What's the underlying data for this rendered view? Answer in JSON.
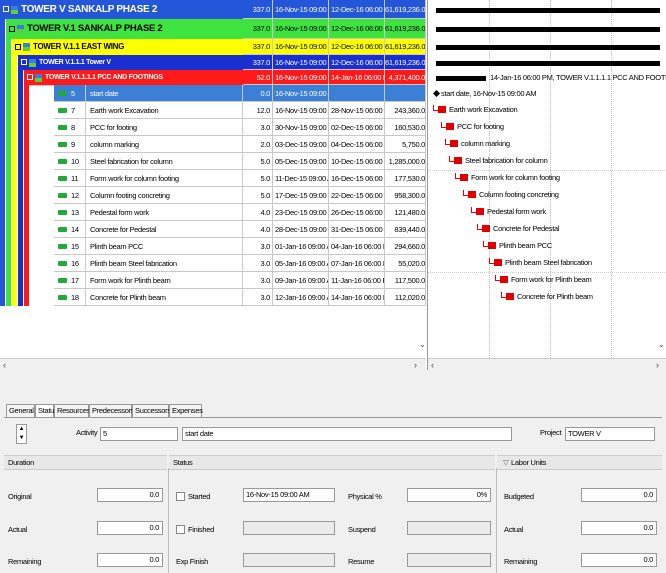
{
  "wbs": [
    {
      "name": "TOWER V  SANKALP PHASE 2",
      "duration": "337.0",
      "start": "16-Nov-15 09:00 AM",
      "finish": "12-Dec-16 06:00 PM",
      "cost": "61,619,236.0",
      "color": "#2456d9",
      "text": "#ffffff",
      "indent": 0,
      "size": "10px"
    },
    {
      "name": "TOWER V.1  SANKALP PHASE 2",
      "duration": "337.0",
      "start": "16-Nov-15 09:00 AM",
      "finish": "12-Dec-16 06:00 PM",
      "cost": "61,619,236.0",
      "color": "#3fe33f",
      "text": "#000000",
      "indent": 1,
      "size": "9.5px"
    },
    {
      "name": "TOWER V.1.1  EAST WING",
      "duration": "337.0",
      "start": "16-Nov-15 09:00 AM",
      "finish": "12-Dec-16 06:00 PM",
      "cost": "61,619,236.0",
      "color": "#ffff00",
      "text": "#000000",
      "indent": 2,
      "size": "8px"
    },
    {
      "name": "TOWER V.1.1.1  Tower V",
      "duration": "337.0",
      "start": "16-Nov-15 09:00 AM",
      "finish": "12-Dec-16 06:00 PM",
      "cost": "61,619,236.0",
      "color": "#1a2fd0",
      "text": "#ffffff",
      "indent": 3,
      "size": "7px"
    },
    {
      "name": "TOWER V.1.1.1.1  PCC AND FOOTINGS",
      "duration": "52.0",
      "start": "16-Nov-15 09:00 AM",
      "finish": "14-Jan-16 06:00 PM",
      "cost": "4,371,400.0",
      "color": "#ff1a1a",
      "text": "#ffffff",
      "indent": 4,
      "size": "7px"
    }
  ],
  "activities": [
    {
      "id": "5",
      "name": "start date",
      "duration": "0.0",
      "start": "16-Nov-15 09:00 AM",
      "finish": "",
      "cost": "",
      "selected": true
    },
    {
      "id": "7",
      "name": "Earth work Excavation",
      "duration": "12.0",
      "start": "16-Nov-15 09:00 AM",
      "finish": "28-Nov-15 06:00 PM",
      "cost": "243,360.0"
    },
    {
      "id": "8",
      "name": "PCC for footing",
      "duration": "3.0",
      "start": "30-Nov-15 09:00 AM",
      "finish": "02-Dec-15 06:00 PM",
      "cost": "160,530.0"
    },
    {
      "id": "9",
      "name": "column marking",
      "duration": "2.0",
      "start": "03-Dec-15 09:00 AM",
      "finish": "04-Dec-15 06:00 PM",
      "cost": "5,750.0"
    },
    {
      "id": "10",
      "name": "Steel fabrication for column",
      "duration": "5.0",
      "start": "05-Dec-15 09:00 AM",
      "finish": "10-Dec-15 06:00 PM",
      "cost": "1,285,000.0"
    },
    {
      "id": "11",
      "name": "Form work for column footing",
      "duration": "5.0",
      "start": "11-Dec-15 09:00 AM",
      "finish": "16-Dec-15 06:00 PM",
      "cost": "177,530.0"
    },
    {
      "id": "12",
      "name": "Column footing concreting",
      "duration": "5.0",
      "start": "17-Dec-15 09:00 AM",
      "finish": "22-Dec-15 06:00 PM",
      "cost": "958,300.0"
    },
    {
      "id": "13",
      "name": "Pedestal form work",
      "duration": "4.0",
      "start": "23-Dec-15 09:00 AM",
      "finish": "26-Dec-15 06:00 PM",
      "cost": "121,480.0"
    },
    {
      "id": "14",
      "name": "Concrete for Pedestal",
      "duration": "4.0",
      "start": "28-Dec-15 09:00 AM",
      "finish": "31-Dec-15 06:00 PM",
      "cost": "839,440.0"
    },
    {
      "id": "15",
      "name": "Plinth beam PCC",
      "duration": "3.0",
      "start": "01-Jan-16 09:00 AM",
      "finish": "04-Jan-16 06:00 PM",
      "cost": "294,660.0"
    },
    {
      "id": "16",
      "name": "Plinth beam Steel fabrication",
      "duration": "3.0",
      "start": "05-Jan-16 09:00 AM",
      "finish": "07-Jan-16 06:00 PM",
      "cost": "55,020.0"
    },
    {
      "id": "17",
      "name": "Form work for Plinth beam",
      "duration": "3.0",
      "start": "09-Jan-16 09:00 AM",
      "finish": "11-Jan-16 06:00 PM",
      "cost": "117,500.0"
    },
    {
      "id": "18",
      "name": "Concrete for Plinth beam",
      "duration": "3.0",
      "start": "12-Jan-16 09:00 AM",
      "finish": "14-Jan-16 06:00 PM",
      "cost": "112,020.0"
    }
  ],
  "gantt": {
    "wbs_label": "14-Jan-16 06:00 PM, TOWER V.1.1.1.1  PCC AND FOOTINGS",
    "milestone_label": "start date, 16-Nov-15 09:00 AM"
  },
  "tabs": [
    "General",
    "Status",
    "Resources",
    "Predecessors",
    "Successors",
    "Expenses"
  ],
  "details": {
    "activity_label": "Activity",
    "activity_id": "5",
    "activity_name": "start date",
    "project_label": "Project",
    "project_value": "TOWER V",
    "duration_header": "Duration",
    "status_header": "Status",
    "labor_header": "Labor Units",
    "original_label": "Original",
    "original_value": "0.0",
    "actual_label": "Actual",
    "actual_value": "0.0",
    "remaining_label": "Remaining",
    "remaining_value": "0.0",
    "started_label": "Started",
    "started_value": "16-Nov-15 09:00 AM",
    "finished_label": "Finished",
    "expfinish_label": "Exp Finish",
    "physical_label": "Physical %",
    "physical_value": "0%",
    "suspend_label": "Suspend",
    "resume_label": "Resume",
    "budgeted_label": "Budgeted",
    "budgeted_value": "0.0",
    "labor_actual_label": "Actual",
    "labor_actual_value": "0.0",
    "labor_remaining_label": "Remaining",
    "labor_remaining_value": "0.0"
  },
  "icons": {
    "scroll_left": "‹",
    "scroll_right": "›",
    "scroll_down": "⌄",
    "spin_up": "▲",
    "spin_down": "▼",
    "collapse": "▽"
  }
}
